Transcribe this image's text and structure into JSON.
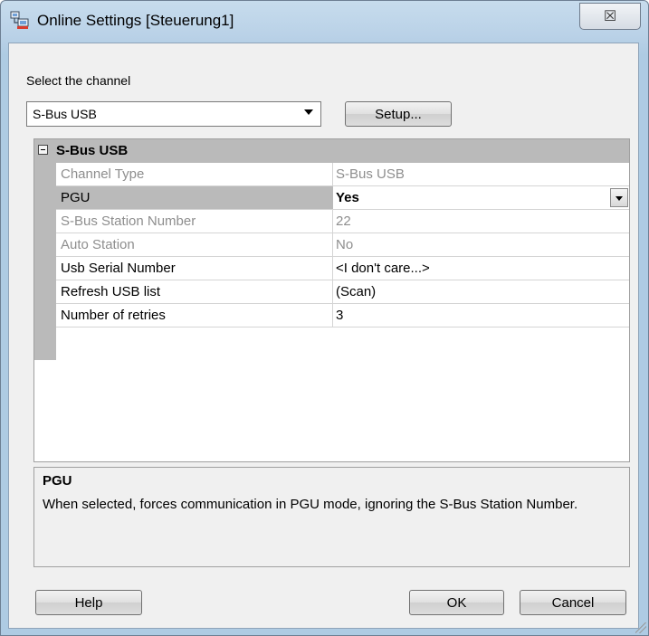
{
  "window": {
    "title": "Online Settings [Steuerung1]",
    "close_label": "☒"
  },
  "channel": {
    "label": "Select the channel",
    "selected": "S-Bus USB",
    "setup_label": "Setup..."
  },
  "grid": {
    "category": "S-Bus USB",
    "rows": [
      {
        "name": "Channel Type",
        "value": "S-Bus USB",
        "state": "readonly"
      },
      {
        "name": "PGU",
        "value": "Yes",
        "state": "selected"
      },
      {
        "name": "S-Bus Station Number",
        "value": "22",
        "state": "readonly"
      },
      {
        "name": "Auto Station",
        "value": "No",
        "state": "readonly"
      },
      {
        "name": "Usb Serial Number",
        "value": "<I don't care...>",
        "state": "normal"
      },
      {
        "name": "Refresh USB list",
        "value": "(Scan)",
        "state": "normal"
      },
      {
        "name": "Number of retries",
        "value": "3",
        "state": "normal"
      }
    ]
  },
  "description": {
    "title": "PGU",
    "text": "When selected, forces communication in PGU mode, ignoring the S-Bus Station Number."
  },
  "buttons": {
    "help": "Help",
    "ok": "OK",
    "cancel": "Cancel"
  }
}
